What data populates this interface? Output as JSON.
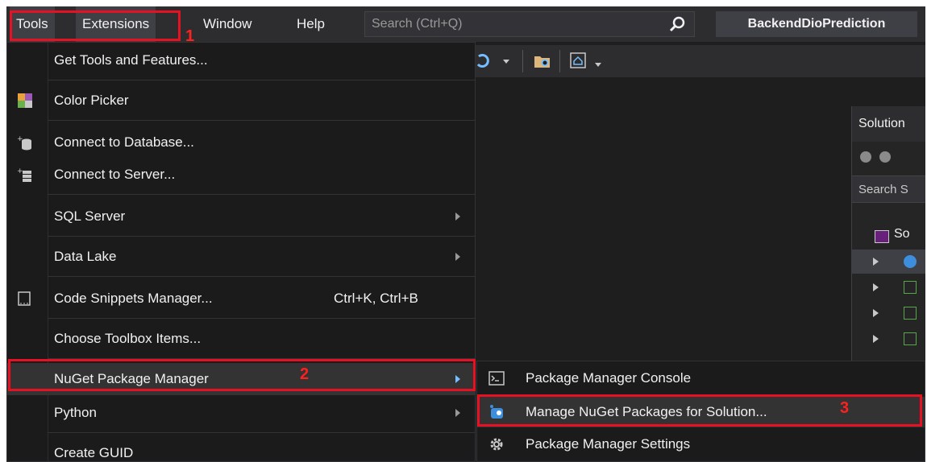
{
  "menubar": {
    "items": [
      {
        "label": "Tools"
      },
      {
        "label": "Extensions"
      },
      {
        "label": "Window"
      },
      {
        "label": "Help"
      }
    ],
    "search_placeholder": "Search (Ctrl+Q)",
    "search_icon": "search-icon",
    "project_name": "BackendDioPrediction"
  },
  "tools_menu": {
    "items": [
      {
        "label": "Get Tools and Features...",
        "icon": "none"
      },
      {
        "label": "Color Picker",
        "icon": "color-picker-icon"
      },
      {
        "label": "Connect to Database...",
        "icon": "database-icon"
      },
      {
        "label": "Connect to Server...",
        "icon": "server-icon"
      },
      {
        "label": "SQL Server",
        "submenu": true
      },
      {
        "label": "Data Lake",
        "submenu": true
      },
      {
        "label": "Code Snippets Manager...",
        "shortcut": "Ctrl+K, Ctrl+B",
        "icon": "snippet-icon"
      },
      {
        "label": "Choose Toolbox Items..."
      },
      {
        "label": "NuGet Package Manager",
        "submenu": true,
        "highlighted": true
      },
      {
        "label": "Python",
        "submenu": true
      },
      {
        "label": "Create GUID"
      }
    ]
  },
  "nuget_submenu": {
    "items": [
      {
        "label": "Package Manager Console",
        "icon": "console-icon"
      },
      {
        "label": "Manage NuGet Packages for Solution...",
        "icon": "nuget-icon",
        "highlighted": true
      },
      {
        "label": "Package Manager Settings",
        "icon": "gear-icon"
      }
    ]
  },
  "solution_explorer": {
    "header": "Solution",
    "search_placeholder": "Search S",
    "root_label": "So"
  },
  "annotations": {
    "step1": "1",
    "step2": "2",
    "step3": "3"
  },
  "colors": {
    "highlight_red": "#e81123",
    "menu_bg": "#1b1b1c",
    "menubar_bg": "#2d2d30"
  }
}
